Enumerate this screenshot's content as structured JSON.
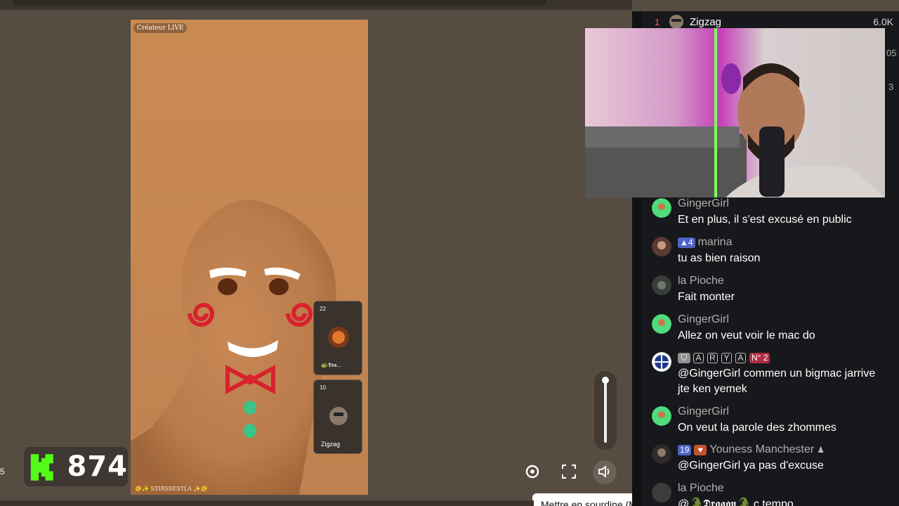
{
  "stream": {
    "live_badge": "Créateur LIVE",
    "footer_text": "🫨✨ STIRSSESTLA ✨🫨",
    "guests": [
      {
        "count": "22",
        "name": "🐢𝕯𝖗𝖆..."
      },
      {
        "count": "10",
        "name": "Zigzag"
      }
    ]
  },
  "kick": {
    "viewer_count": "874",
    "brand_color": "#53fc18"
  },
  "left_edge_char": "5",
  "player": {
    "mute_tooltip": "Mettre en sourdine (M)",
    "icons": [
      "settings-icon",
      "fullscreen-icon",
      "volume-icon"
    ]
  },
  "chat": {
    "top_gifter": {
      "rank": "1",
      "name": "Zigzag",
      "amount": "6.0K"
    },
    "side_numbers": [
      "05",
      "3"
    ],
    "messages": [
      {
        "user": "GingerGirl",
        "text": "Et en plus, il s'est excusé en public",
        "user_color": "#b0b0b0"
      },
      {
        "user": "marina",
        "badges": [
          "▲4"
        ],
        "text": "tu as bien raison"
      },
      {
        "user": "la Pioche",
        "text": "Fait monter"
      },
      {
        "user": "GingerGirl",
        "text": "Allez on veut voir le mac do"
      },
      {
        "user": "ARYA",
        "user_letters": [
          "A",
          "R",
          "Y",
          "A"
        ],
        "badges": [
          "N° 2"
        ],
        "text": "@GingerGirl commen un bigmac jarrive jte ken yemek"
      },
      {
        "user": "GingerGirl",
        "text": "On veut la parole des zhommes"
      },
      {
        "user": "Youness Manchester",
        "badges": [
          "19"
        ],
        "text": "@GingerGirl ya pas d'excuse"
      },
      {
        "user": "la Pioche",
        "text": "@🐊𝕯𝖗𝖆𝖌𝖔𝖓🐊 c tempo"
      }
    ]
  }
}
